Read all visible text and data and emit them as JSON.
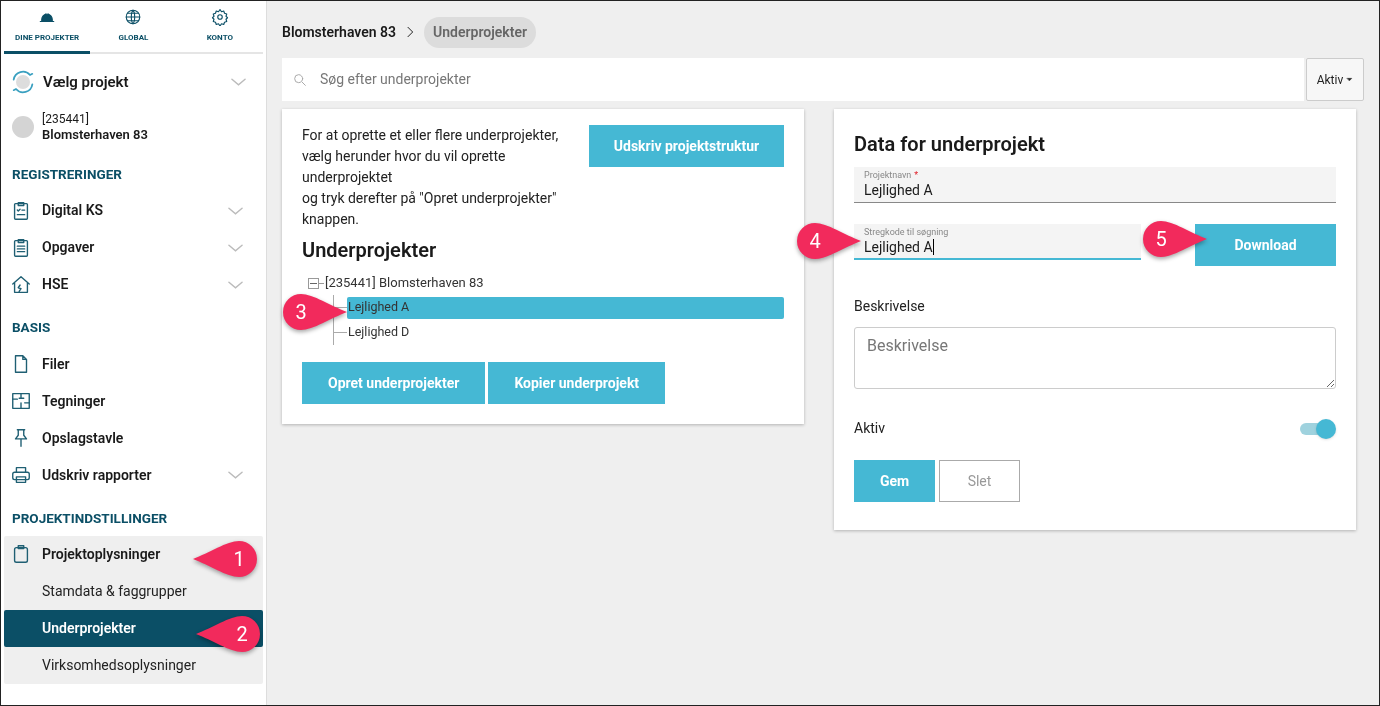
{
  "nav_tabs": [
    {
      "label": "DINE PROJEKTER",
      "selected": true
    },
    {
      "label": "GLOBAL",
      "selected": false
    },
    {
      "label": "KONTO",
      "selected": false
    }
  ],
  "project_picker": {
    "label": "Vælg projekt"
  },
  "project": {
    "id": "[235441]",
    "name": "Blomsterhaven 83"
  },
  "sections": [
    {
      "title": "REGISTRERINGER",
      "items": [
        {
          "label": "Digital KS",
          "expandable": true
        },
        {
          "label": "Opgaver",
          "expandable": true
        },
        {
          "label": "HSE",
          "expandable": true
        }
      ]
    },
    {
      "title": "BASIS",
      "items": [
        {
          "label": "Filer",
          "expandable": false
        },
        {
          "label": "Tegninger",
          "expandable": false
        },
        {
          "label": "Opslagstavle",
          "expandable": false
        },
        {
          "label": "Udskriv rapporter",
          "expandable": true
        }
      ]
    },
    {
      "title": "PROJEKTINDSTILLINGER",
      "items": [
        {
          "label": "Projektoplysninger",
          "expanded": true,
          "children": [
            {
              "label": "Stamdata & faggrupper",
              "selected": false
            },
            {
              "label": "Underprojekter",
              "selected": true
            },
            {
              "label": "Virksomhedsoplysninger",
              "selected": false
            }
          ]
        }
      ]
    }
  ],
  "breadcrumb": [
    {
      "label": "Blomsterhaven 83",
      "current": false
    },
    {
      "label": "Underprojekter",
      "current": true
    }
  ],
  "search": {
    "placeholder": "Søg efter underprojekter"
  },
  "filter": {
    "label": "Aktiv"
  },
  "left_card": {
    "instructions": "For at oprette et eller flere underprojekter, vælg herunder hvor du vil oprette underprojektet\nog tryk derefter på \"Opret underprojekter\" knappen.",
    "print_button": "Udskriv projektstruktur",
    "tree_title": "Underprojekter",
    "tree": [
      {
        "label": "[235441] Blomsterhaven 83",
        "expanded": true,
        "selected": false,
        "children": [
          {
            "label": "Lejlighed A",
            "selected": true
          },
          {
            "label": "Lejlighed D",
            "selected": false
          }
        ]
      }
    ],
    "buttons": [
      "Opret underprojekter",
      "Kopier underprojekt"
    ]
  },
  "right_card": {
    "title": "Data for underprojekt",
    "name_field": {
      "label": "Projektnavn",
      "required_mark": "*",
      "value": "Lejlighed A",
      "focused": false
    },
    "barcode_field": {
      "label": "Stregkode til søgning",
      "value": "Lejlighed A",
      "focused": true
    },
    "download_button": "Download",
    "description": {
      "label": "Beskrivelse",
      "placeholder": "Beskrivelse"
    },
    "active": {
      "label": "Aktiv",
      "on": true
    },
    "buttons": [
      {
        "label": "Gem",
        "kind": "primary"
      },
      {
        "label": "Slet",
        "kind": "secondary"
      }
    ]
  },
  "callouts": [
    {
      "number": "1",
      "points_left": true
    },
    {
      "number": "2",
      "points_left": true
    },
    {
      "number": "3",
      "points_left": false
    },
    {
      "number": "4",
      "points_left": false
    },
    {
      "number": "5",
      "points_left": false
    }
  ]
}
